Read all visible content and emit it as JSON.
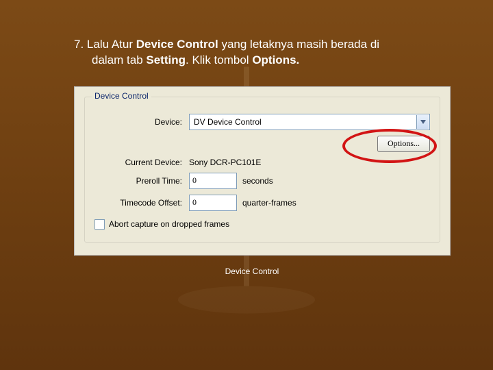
{
  "instruction": {
    "num": "7.",
    "t1": "Lalu Atur ",
    "b1": "Device Control",
    "t2": " yang letaknya masih berada di",
    "t3": "dalam tab ",
    "b2": "Setting",
    "t4": ". Klik tombol ",
    "b3": "Options.",
    "t5": ""
  },
  "panel": {
    "group_title": "Device Control",
    "device_label": "Device:",
    "device_value": "DV Device Control",
    "options_button": "Options...",
    "current_label": "Current Device:",
    "current_value": "Sony DCR-PC101E",
    "preroll_label": "Preroll Time:",
    "preroll_value": "0",
    "preroll_unit": "seconds",
    "tc_label": "Timecode Offset:",
    "tc_value": "0",
    "tc_unit": "quarter-frames",
    "abort_label": "Abort capture on dropped frames"
  },
  "caption": "Device Control"
}
